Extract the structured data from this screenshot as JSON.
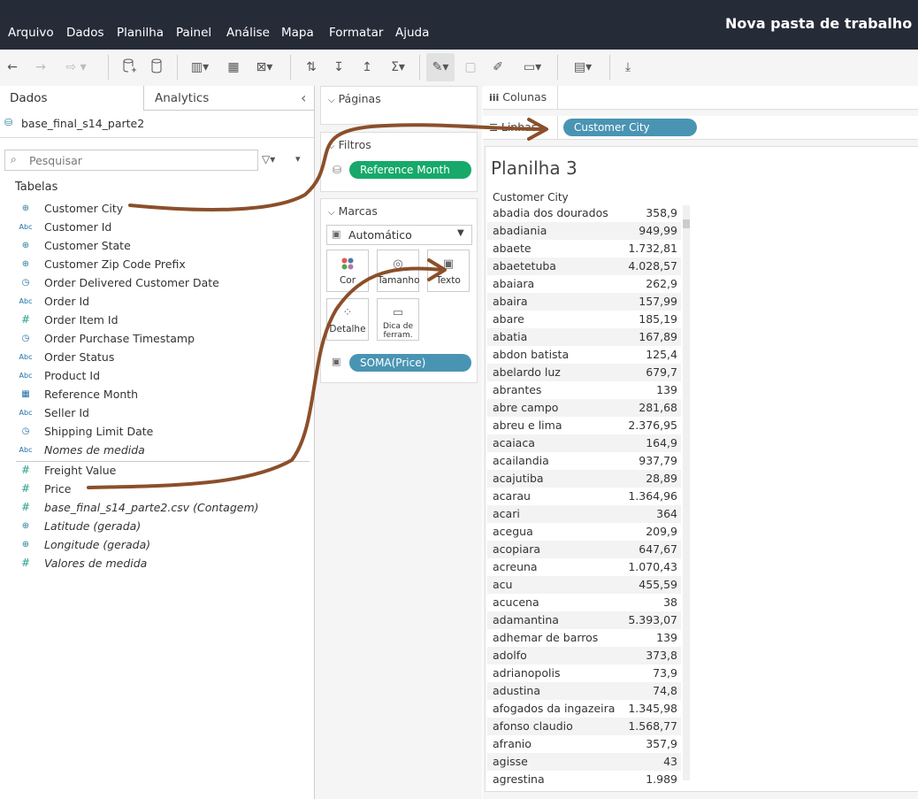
{
  "menu": {
    "items": [
      "Arquivo",
      "Dados",
      "Planilha",
      "Painel",
      "Análise",
      "Mapa",
      "Formatar",
      "Ajuda"
    ],
    "window_title": "Nova pasta de trabalho (Tabl"
  },
  "data_pane": {
    "tab_dados": "Dados",
    "tab_analytics": "Analytics",
    "collapse_glyph": "‹",
    "datasource": "base_final_s14_parte2",
    "search_placeholder": "Pesquisar",
    "section_title": "Tabelas",
    "dimensions": [
      {
        "label": "Customer City",
        "icon": "globe-icon"
      },
      {
        "label": "Customer Id",
        "icon": "abc-icon"
      },
      {
        "label": "Customer State",
        "icon": "globe-icon"
      },
      {
        "label": "Customer Zip Code Prefix",
        "icon": "globe-icon"
      },
      {
        "label": "Order Delivered Customer Date",
        "icon": "calendar-time-icon"
      },
      {
        "label": "Order Id",
        "icon": "abc-icon"
      },
      {
        "label": "Order Item Id",
        "icon": "hash-icon"
      },
      {
        "label": "Order Purchase Timestamp",
        "icon": "calendar-time-icon"
      },
      {
        "label": "Order Status",
        "icon": "abc-icon"
      },
      {
        "label": "Product Id",
        "icon": "abc-icon"
      },
      {
        "label": "Reference Month",
        "icon": "calendar-icon"
      },
      {
        "label": "Seller Id",
        "icon": "abc-icon"
      },
      {
        "label": "Shipping Limit Date",
        "icon": "calendar-time-icon"
      },
      {
        "label": "Nomes de medida",
        "icon": "abc-icon"
      }
    ],
    "measures": [
      {
        "label": "Freight Value",
        "icon": "hash-icon"
      },
      {
        "label": "Price",
        "icon": "hash-icon"
      },
      {
        "label": "base_final_s14_parte2.csv (Contagem)",
        "icon": "hash-icon"
      },
      {
        "label": "Latitude (gerada)",
        "icon": "globe-icon"
      },
      {
        "label": "Longitude (gerada)",
        "icon": "globe-icon"
      },
      {
        "label": "Valores de medida",
        "icon": "hash-icon"
      }
    ]
  },
  "cards": {
    "pages_title": "Páginas",
    "filters_title": "Filtros",
    "filter_pill": "Reference Month",
    "marks_title": "Marcas",
    "mark_type": "Automático",
    "mark_buttons": {
      "color": "Cor",
      "size": "Tamanho",
      "text": "Texto",
      "detail": "Detalhe",
      "tooltip_line1": "Dica de",
      "tooltip_line2": "ferram."
    },
    "text_pill": "SOMA(Price)"
  },
  "shelves": {
    "columns_label": "Colunas",
    "rows_label": "Linhas",
    "rows_pill": "Customer City"
  },
  "sheet": {
    "title": "Planilha 3",
    "column_header": "Customer City",
    "rows": [
      {
        "city": "abadia dos dourados",
        "value": "358,9"
      },
      {
        "city": "abadiania",
        "value": "949,99"
      },
      {
        "city": "abaete",
        "value": "1.732,81"
      },
      {
        "city": "abaetetuba",
        "value": "4.028,57"
      },
      {
        "city": "abaiara",
        "value": "262,9"
      },
      {
        "city": "abaira",
        "value": "157,99"
      },
      {
        "city": "abare",
        "value": "185,19"
      },
      {
        "city": "abatia",
        "value": "167,89"
      },
      {
        "city": "abdon batista",
        "value": "125,4"
      },
      {
        "city": "abelardo luz",
        "value": "679,7"
      },
      {
        "city": "abrantes",
        "value": "139"
      },
      {
        "city": "abre campo",
        "value": "281,68"
      },
      {
        "city": "abreu e lima",
        "value": "2.376,95"
      },
      {
        "city": "acaiaca",
        "value": "164,9"
      },
      {
        "city": "acailandia",
        "value": "937,79"
      },
      {
        "city": "acajutiba",
        "value": "28,89"
      },
      {
        "city": "acarau",
        "value": "1.364,96"
      },
      {
        "city": "acari",
        "value": "364"
      },
      {
        "city": "acegua",
        "value": "209,9"
      },
      {
        "city": "acopiara",
        "value": "647,67"
      },
      {
        "city": "acreuna",
        "value": "1.070,43"
      },
      {
        "city": "acu",
        "value": "455,59"
      },
      {
        "city": "acucena",
        "value": "38"
      },
      {
        "city": "adamantina",
        "value": "5.393,07"
      },
      {
        "city": "adhemar de barros",
        "value": "139"
      },
      {
        "city": "adolfo",
        "value": "373,8"
      },
      {
        "city": "adrianopolis",
        "value": "73,9"
      },
      {
        "city": "adustina",
        "value": "74,8"
      },
      {
        "city": "afogados da ingazeira",
        "value": "1.345,98"
      },
      {
        "city": "afonso claudio",
        "value": "1.568,77"
      },
      {
        "city": "afranio",
        "value": "357,9"
      },
      {
        "city": "agisse",
        "value": "43"
      },
      {
        "city": "agrestina",
        "value": "1.989"
      }
    ]
  },
  "colors": {
    "menubar_bg": "#262b38",
    "pill_green": "#16a96a",
    "pill_blue": "#4a94b3",
    "arrow": "#8b4f2a"
  }
}
